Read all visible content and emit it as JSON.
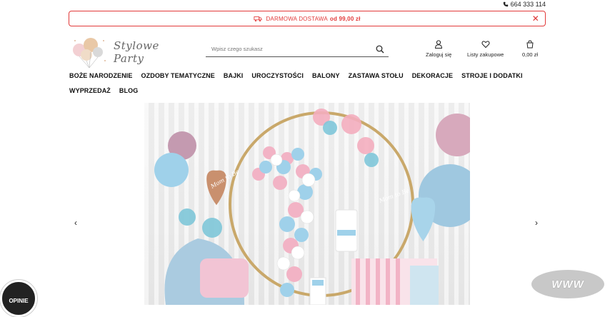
{
  "header": {
    "phone": "664 333 114",
    "promo": {
      "text": "DARMOWA DOSTAWA",
      "bold": "od 99,00 zł",
      "close": "✕"
    },
    "logo_text": "Stylowe Party",
    "search": {
      "placeholder": "Wpisz czego szukasz",
      "value": ""
    },
    "user": {
      "login": "Zaloguj się",
      "wishlist": "Listy zakupowe",
      "cart": "0,00 zł"
    }
  },
  "nav": [
    "BOŻE NARODZENIE",
    "OZDOBY TEMATYCZNE",
    "BAJKI",
    "UROCZYSTOŚCI",
    "BALONY",
    "ZASTAWA STOŁU",
    "DEKORACJE",
    "STROJE I DODATKI",
    "WYPRZEDAŻ",
    "BLOG"
  ],
  "hero": {
    "balloon_text_1": "Mom to Be",
    "balloon_text_2": "Mom to Be"
  },
  "slider": {
    "prev": "‹",
    "next": "›"
  },
  "badge": {
    "text": "OPINIE"
  },
  "watermark": {
    "text": "WWW"
  }
}
